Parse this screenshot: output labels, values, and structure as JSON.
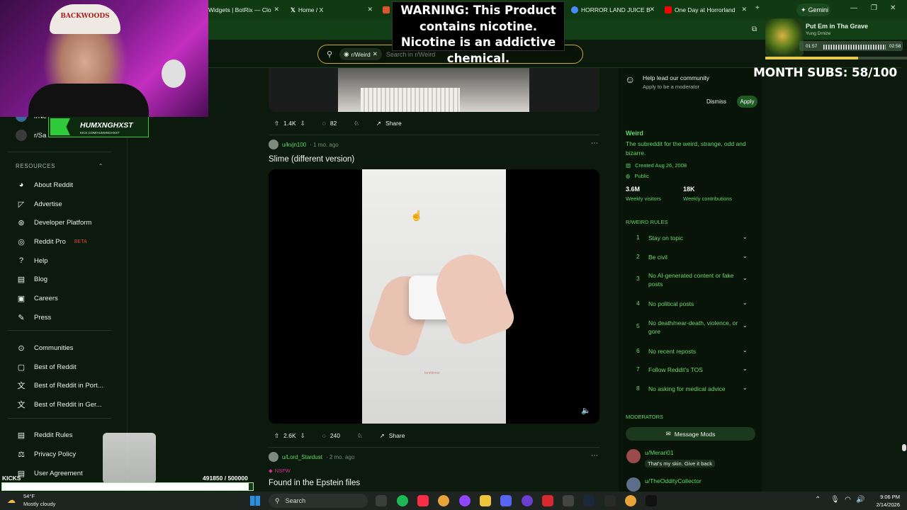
{
  "browser": {
    "tabs": [
      {
        "label": "Widgets | BotRix — Clo",
        "fav_color": "#3a3a3a"
      },
      {
        "label": "Home / X",
        "fav_color": "#000000"
      },
      {
        "label": "HORROR LAND JUICE B",
        "fav_color": "#4a8cff"
      },
      {
        "label": "One Day at Horrorland",
        "fav_color": "#ff0000"
      }
    ],
    "gemini_label": "Gemini"
  },
  "warning": {
    "text": "WARNING: This Product contains nicotine. Nicotine is an addictive chemical."
  },
  "search": {
    "chip": "r/Weird",
    "placeholder": "Search in r/Weird"
  },
  "webcam": {
    "hat_text": "BACKWOODS"
  },
  "stream_overlay": {
    "streamer_name": "HUMXNGHXST",
    "streamer_url": "KICK.COM/HUMXNGHXST",
    "month_subs": "MONTH SUBS: 58/100",
    "kicks_label": "KICKS",
    "kicks_count": "491850  / 500000",
    "kicks_progress": 0.9837
  },
  "music": {
    "song": "Put Em in Tha Grave",
    "artist": "Yung Drnize",
    "elapsed": "01:57",
    "duration": "02:58",
    "progress": 0.657
  },
  "sidebar": {
    "partial_items": [
      "r/Ne",
      "r/Sa"
    ],
    "resources_header": "RESOURCES",
    "resources": [
      {
        "label": "About Reddit",
        "icon": "reddit-icon"
      },
      {
        "label": "Advertise",
        "icon": "megaphone-icon"
      },
      {
        "label": "Developer Platform",
        "icon": "code-icon"
      },
      {
        "label": "Reddit Pro",
        "icon": "pro-icon",
        "badge": "BETA"
      },
      {
        "label": "Help",
        "icon": "help-icon"
      },
      {
        "label": "Blog",
        "icon": "book-icon"
      },
      {
        "label": "Careers",
        "icon": "briefcase-icon"
      },
      {
        "label": "Press",
        "icon": "microphone-icon"
      }
    ],
    "discover": [
      {
        "label": "Communities",
        "icon": "communities-icon"
      },
      {
        "label": "Best of Reddit",
        "icon": "best-icon"
      },
      {
        "label": "Best of Reddit in Port...",
        "icon": "translate-icon"
      },
      {
        "label": "Best of Reddit in Ger...",
        "icon": "translate-icon"
      }
    ],
    "legal": [
      {
        "label": "Reddit Rules",
        "icon": "rules-icon"
      },
      {
        "label": "Privacy Policy",
        "icon": "privacy-icon"
      },
      {
        "label": "User Agreement",
        "icon": "agreement-icon"
      }
    ]
  },
  "feed": {
    "post0": {
      "upvotes": "1.4K",
      "comments": "82",
      "share": "Share"
    },
    "post1": {
      "author": "u/kvjn100",
      "time": "· 1 mo. ago",
      "title": "Slime (different version)",
      "upvotes": "2.6K",
      "comments": "240",
      "share": "Share",
      "video_watermark": "tomblimer"
    },
    "post2": {
      "author": "u/Lord_Stardust",
      "time": "· 2 mo. ago",
      "nsfw": "NSFW",
      "title": "Found in the Epstein files"
    }
  },
  "rail": {
    "mod_prompt": {
      "title": "Help lead our community",
      "subtitle": "Apply to be a moderator",
      "dismiss": "Dismiss",
      "apply": "Apply"
    },
    "community": {
      "name": "Weird",
      "description": "The subreddit for the weird, strange, odd and bizarre.",
      "created": "Created Aug 26, 2008",
      "visibility": "Public",
      "visitors_value": "3.6M",
      "visitors_label": "Weekly visitors",
      "contrib_value": "18K",
      "contrib_label": "Weekly contributions"
    },
    "rules_header": "R/WEIRD RULES",
    "rules": [
      {
        "num": "1",
        "text": "Stay on topic"
      },
      {
        "num": "2",
        "text": "Be civil"
      },
      {
        "num": "3",
        "text": "No AI-generated content or fake posts"
      },
      {
        "num": "4",
        "text": "No political posts"
      },
      {
        "num": "5",
        "text": "No death/near-death, violence, or gore"
      },
      {
        "num": "6",
        "text": "No recent reposts"
      },
      {
        "num": "7",
        "text": "Follow Reddit's TOS"
      },
      {
        "num": "8",
        "text": "No asking for medical advice"
      }
    ],
    "moderators_header": "MODERATORS",
    "message_mods": "Message Mods",
    "mods": [
      {
        "name": "u/Merari01",
        "flair": "That's my skin. Give it back"
      },
      {
        "name": "u/TheOddityCollector",
        "flair": ""
      }
    ]
  },
  "taskbar": {
    "temp": "54°F",
    "weather": "Mostly cloudy",
    "search": "Search",
    "time": "9:06 PM",
    "date": "2/14/2026"
  },
  "colors": {
    "accent_green": "#63d96b",
    "header_green": "#0f3a12",
    "warning_bg": "#000000"
  }
}
